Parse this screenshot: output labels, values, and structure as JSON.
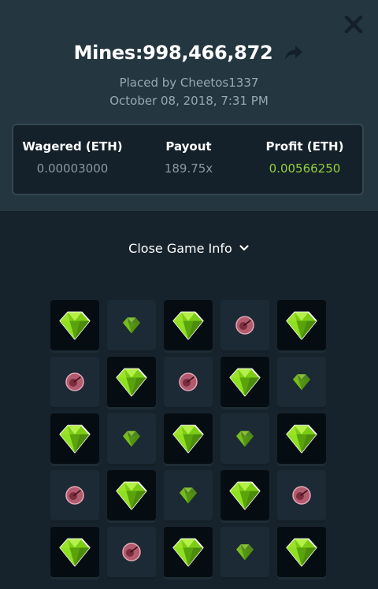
{
  "game": {
    "title": "Mines:998,466,872",
    "placed_by": "Placed by Cheetos1337",
    "date": "October 08, 2018, 7:31 PM"
  },
  "stats": {
    "wagered_label": "Wagered (ETH)",
    "wagered_value": "0.00003000",
    "payout_label": "Payout",
    "payout_value": "189.75x",
    "profit_label": "Profit (ETH)",
    "profit_value": "0.00566250"
  },
  "toggle": {
    "label": "Close Game Info"
  },
  "colors": {
    "header_bg": "#243640",
    "page_bg": "#17232c",
    "profit": "#93cf3e",
    "gem": "#8fe11f",
    "mine": "#b25a6e"
  },
  "icons": {
    "close": "close-icon",
    "share": "share-icon",
    "chevron": "chevron-down-icon",
    "gem": "gem-icon",
    "mine": "mine-icon"
  },
  "board": {
    "rows": [
      [
        "gem-revealed",
        "gem",
        "gem-revealed",
        "mine",
        "gem-revealed"
      ],
      [
        "mine",
        "gem-revealed",
        "mine",
        "gem-revealed",
        "gem"
      ],
      [
        "gem-revealed",
        "gem",
        "gem-revealed",
        "gem",
        "gem-revealed"
      ],
      [
        "mine",
        "gem-revealed",
        "gem",
        "gem-revealed",
        "mine"
      ],
      [
        "gem-revealed",
        "mine",
        "gem-revealed",
        "gem",
        "gem-revealed"
      ]
    ]
  }
}
